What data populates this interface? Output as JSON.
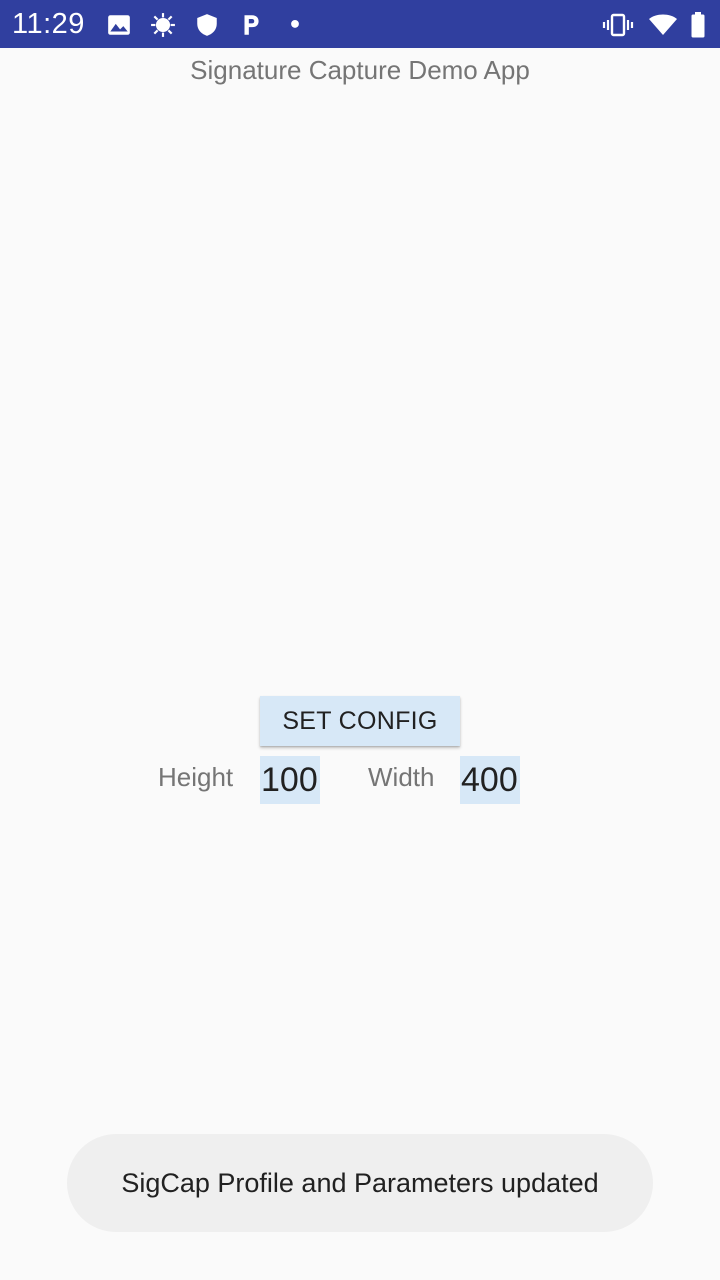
{
  "status_bar": {
    "time": "11:29",
    "left_icons": [
      "image-icon",
      "sun-icon",
      "shield-icon",
      "parking-icon",
      "notification-dot-icon"
    ],
    "right_icons": [
      "vibrate-icon",
      "wifi-icon",
      "battery-icon"
    ],
    "background_color": "#303f9f"
  },
  "app": {
    "title": "Signature Capture Demo App"
  },
  "config": {
    "set_config_label": "SET CONFIG",
    "height_label": "Height",
    "height_value": "100",
    "width_label": "Width",
    "width_value": "400",
    "field_background": "#d7e8f7"
  },
  "toast": {
    "message": "SigCap Profile and Parameters updated"
  }
}
